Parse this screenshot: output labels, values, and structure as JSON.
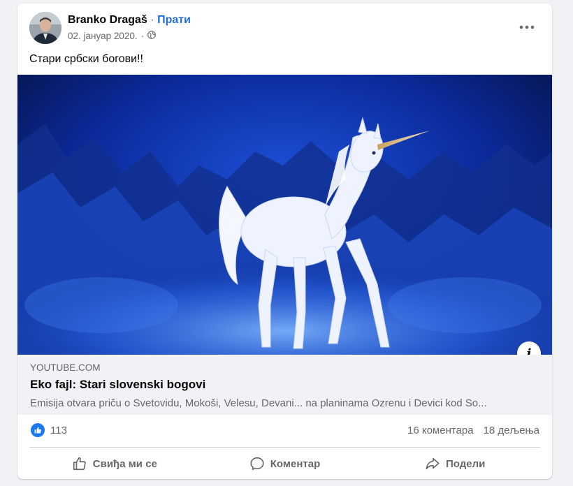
{
  "post": {
    "author": "Branko Dragaš",
    "separator": "·",
    "follow_label": "Прати",
    "date": "02. јануар 2020.",
    "date_separator": "·",
    "audience_icon": "globe-icon",
    "more_icon": "more-horizontal-icon",
    "text": "Стари србски богови!!"
  },
  "link_preview": {
    "domain": "YOUTUBE.COM",
    "title": "Eko fajl: Stari slovenski bogovi",
    "description": "Emisija otvara priču o Svetovidu, Mokoši, Velesu, Devani... na planinama Ozrenu i Devici kod So...",
    "info_icon": "i"
  },
  "stats": {
    "reaction_icon": "like-icon",
    "likes": "113",
    "comments": "16 коментара",
    "shares": "18 дељења"
  },
  "actions": {
    "like_label": "Свиђа ми се",
    "comment_label": "Коментар",
    "share_label": "Подели"
  },
  "colors": {
    "accent": "#216fdb",
    "like_blue": "#1877f2",
    "secondary_text": "#65676b",
    "preview_bg": "#f0f2f5"
  }
}
